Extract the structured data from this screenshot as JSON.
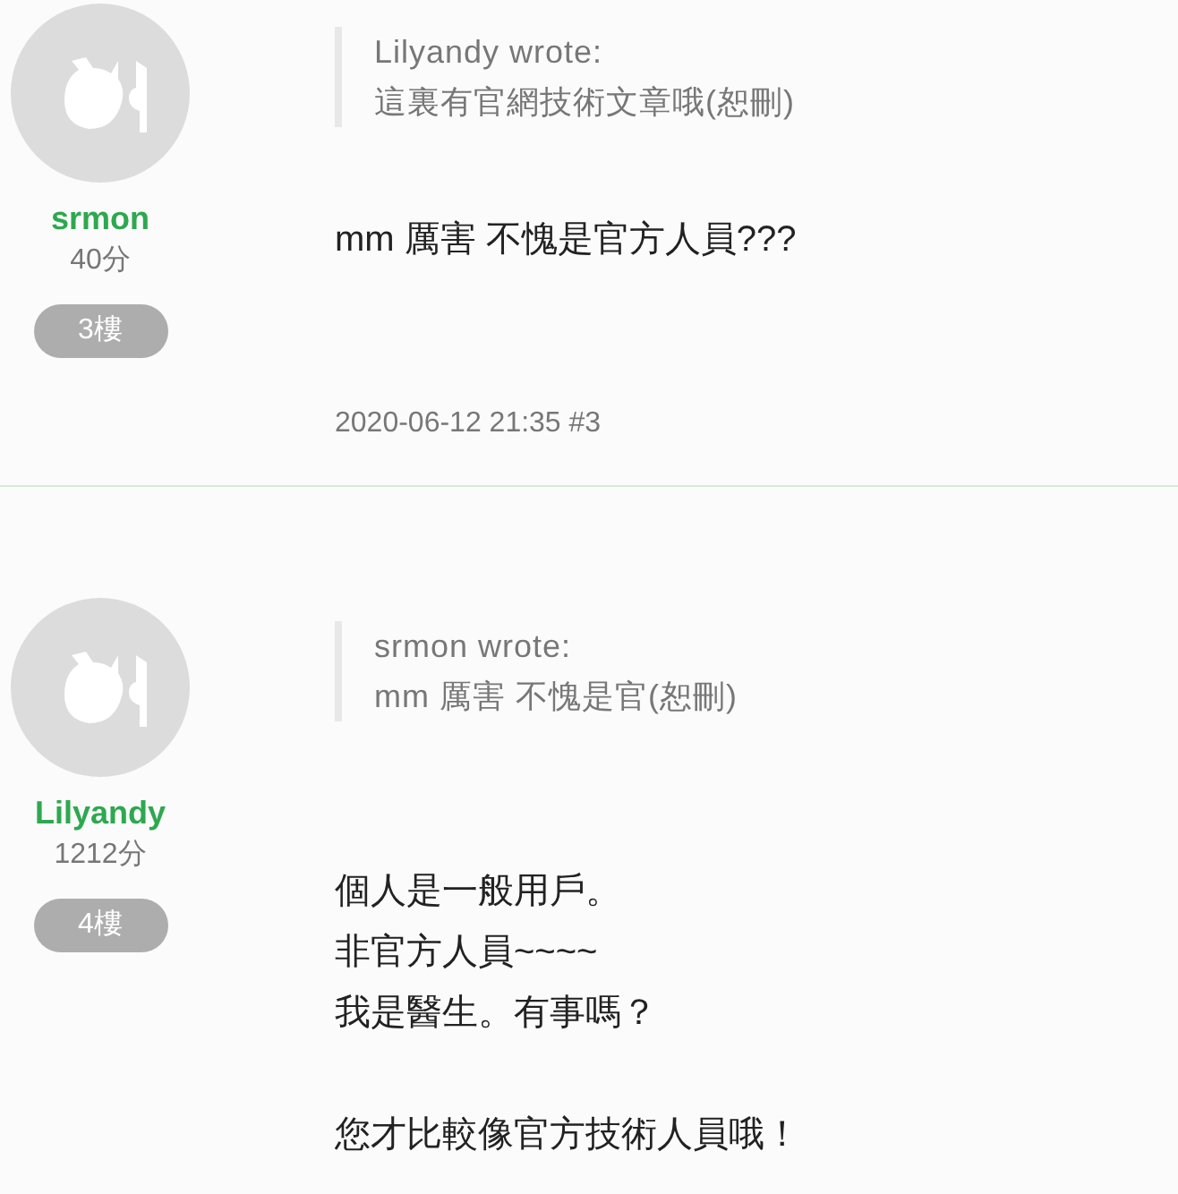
{
  "posts": [
    {
      "username": "srmon",
      "points": "40分",
      "floor": "3樓",
      "quote": {
        "author": "Lilyandy wrote:",
        "text": "這裏有官網技術文章哦(恕刪)"
      },
      "paragraphs": [
        [
          "mm 厲害 不愧是官方人員???"
        ]
      ],
      "footer": "2020-06-12 21:35 #3"
    },
    {
      "username": "Lilyandy",
      "points": "1212分",
      "floor": "4樓",
      "quote": {
        "author": "srmon wrote:",
        "text": "mm 厲害 不愧是官(恕刪)"
      },
      "paragraphs": [
        [
          "個人是一般用戶。",
          "非官方人員~~~~",
          "我是醫生。有事嗎？"
        ],
        [
          "您才比較像官方技術人員哦！"
        ]
      ]
    }
  ]
}
